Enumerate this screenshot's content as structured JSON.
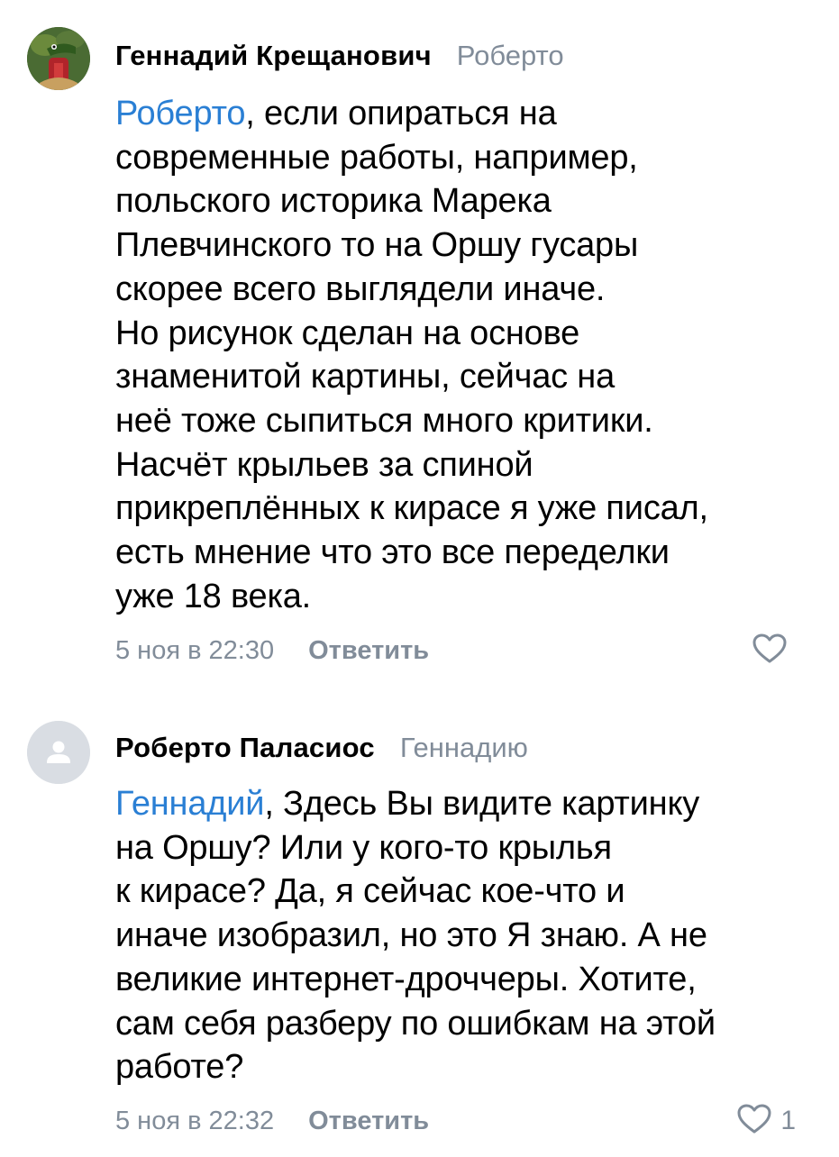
{
  "comments": [
    {
      "author": "Геннадий Крещанович",
      "reply_to": "Роберто",
      "mention": "Роберто",
      "lines": [
        ", если опираться на",
        "современные работы, например,",
        "польского историка Марека",
        "Плевчинского то на Оршу гусары",
        "скорее всего выглядели иначе.",
        "Но рисунок сделан на основе",
        "знаменитой картины, сейчас на",
        "неё тоже сыпиться много критики.",
        "Насчёт крыльев за спиной",
        "прикреплённых к кирасе я уже писал,",
        "есть мнение что это все переделки",
        "уже 18 века."
      ],
      "date": "5 ноя в 22:30",
      "reply_label": "Ответить",
      "likes": "",
      "avatar_icon": "crocodile-avatar-icon"
    },
    {
      "author": "Роберто Паласиос",
      "reply_to": "Геннадию",
      "mention": "Геннадий",
      "lines": [
        ", Здесь Вы видите картинку",
        "на Оршу? Или у кого-то крылья",
        "к кирасе? Да, я сейчас кое-что и",
        "иначе изобразил, но это Я знаю. А не",
        "великие интернет-дроччеры. Хотите,",
        "сам себя разберу по ошибкам на этой",
        "работе?"
      ],
      "date": "5 ноя в 22:32",
      "reply_label": "Ответить",
      "likes": "1",
      "avatar_icon": "default-user-avatar-icon"
    }
  ],
  "colors": {
    "mention": "#2a7fd4",
    "secondary": "#818c99",
    "placeholder_avatar": "#d9dde3"
  }
}
